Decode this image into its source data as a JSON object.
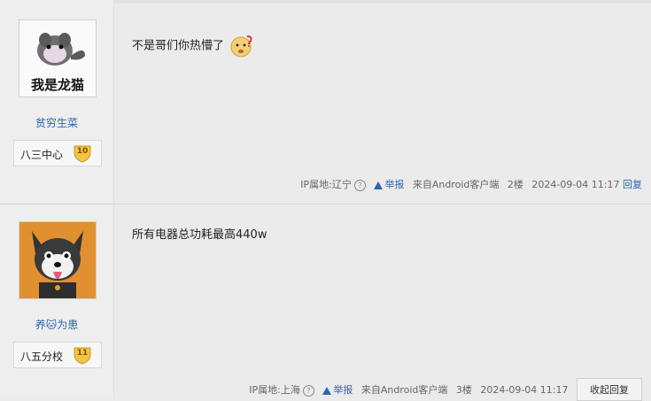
{
  "posts": [
    {
      "avatar_text": "我是龙猫",
      "username": "贫穷生菜",
      "badge_label": "八三中心",
      "badge_level": "10",
      "content_text": "不是哥们你热懵了",
      "emoji_icon": "sweating-face-icon",
      "ip_location": "IP属地:辽宁",
      "report_label": "举报",
      "source": "来自Android客户端",
      "floor": "2楼",
      "timestamp": "2024-09-04 11:17",
      "reply_label": "回复"
    },
    {
      "username": "养🐱为患",
      "badge_label": "八五分校",
      "badge_level": "11",
      "content_text": "所有电器总功耗最高440w",
      "ip_location": "IP属地:上海",
      "report_label": "举报",
      "source": "来自Android客户端",
      "floor": "3楼",
      "timestamp": "2024-09-04 11:17",
      "reply_label": "收起回复"
    }
  ],
  "colors": {
    "link": "#2d64b3",
    "badge_gold": "#f2c544",
    "avatar2_bg": "#e0902f"
  }
}
